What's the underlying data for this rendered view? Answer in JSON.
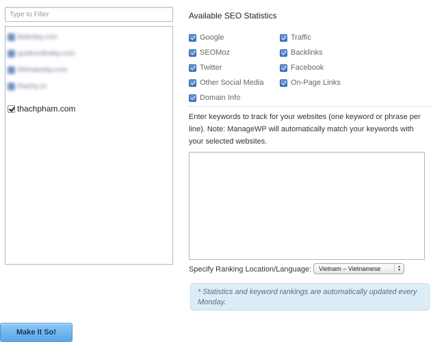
{
  "filter": {
    "placeholder": "Type to Filter"
  },
  "sites": {
    "blurred_items": [
      {
        "label": "lkatoday.com"
      },
      {
        "label": "guidesrdtoday.com"
      },
      {
        "label": "thhinatoday.com"
      },
      {
        "label": "thachy.co"
      }
    ],
    "selected_site": {
      "label": "thachpham.com",
      "checked": true
    }
  },
  "seo_stats": {
    "title": "Available SEO Statistics",
    "column1": [
      {
        "label": "Google",
        "checked": true
      },
      {
        "label": "SEOMoz",
        "checked": true
      },
      {
        "label": "Twitter",
        "checked": true
      },
      {
        "label": "Other Social Media",
        "checked": true
      },
      {
        "label": "Domain Info",
        "checked": true
      }
    ],
    "column2": [
      {
        "label": "Traffic",
        "checked": true
      },
      {
        "label": "Backlinks",
        "checked": true
      },
      {
        "label": "Facebook",
        "checked": true
      },
      {
        "label": "On-Page Links",
        "checked": true
      }
    ]
  },
  "keywords": {
    "instructions": "Enter keywords to track for your websites (one keyword or phrase per line). Note: ManageWP will automatically match your keywords with your selected websites.",
    "value": ""
  },
  "location": {
    "label": "Specify Ranking Location/Language:",
    "selected": "Vietnam – Vietnamese"
  },
  "notice": {
    "text": "* Statistics and keyword rankings are automatically updated every Monday."
  },
  "submit": {
    "label": "Make It So!"
  },
  "colors": {
    "checkbox_blue": "#3b73c4",
    "notice_bg": "#dcedf7",
    "button_blue": "#58a7e8"
  }
}
